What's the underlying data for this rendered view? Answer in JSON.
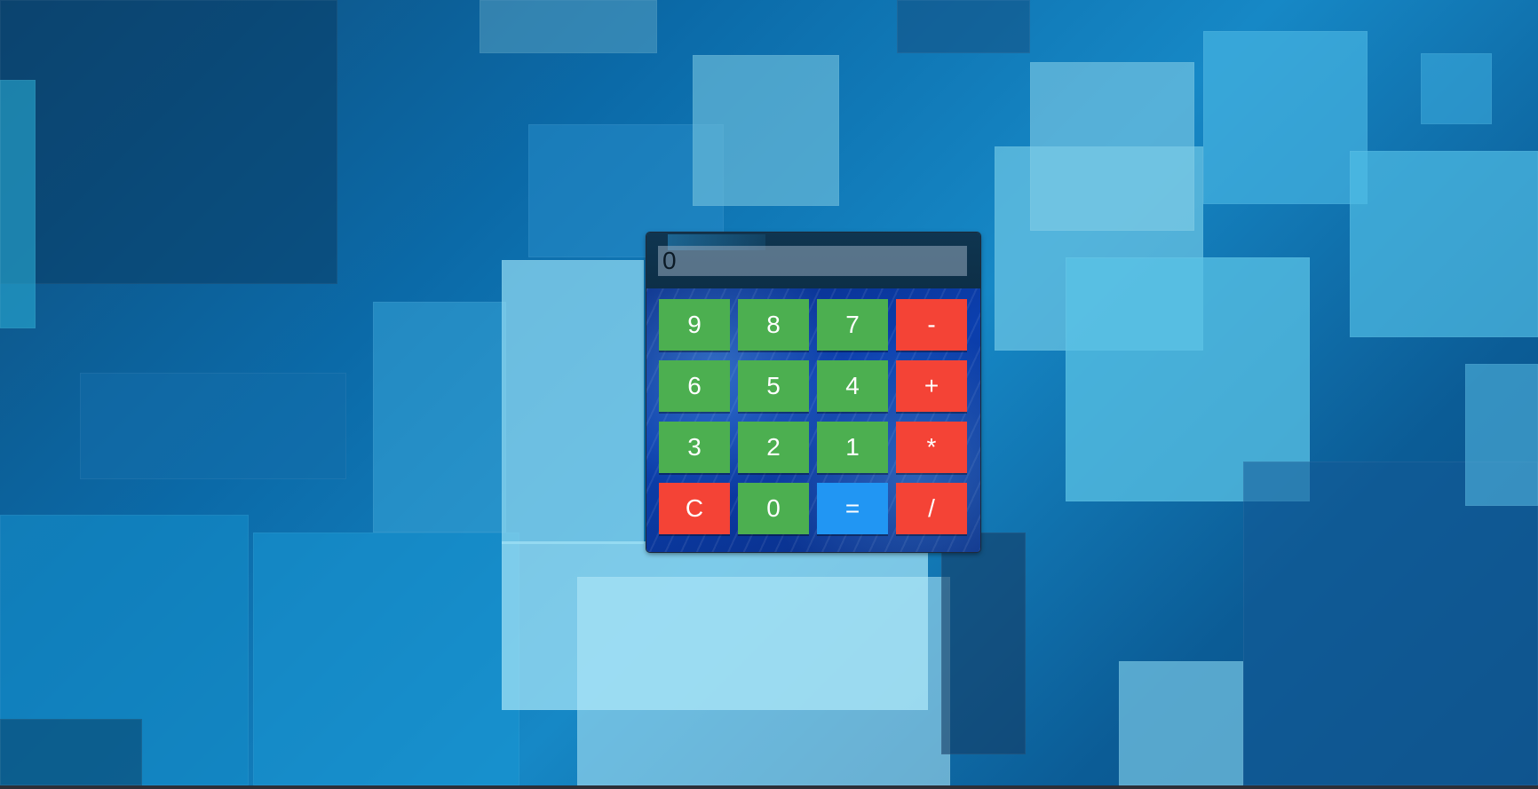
{
  "calculator": {
    "display_value": "0",
    "keys": {
      "k9": "9",
      "k8": "8",
      "k7": "7",
      "minus": "-",
      "k6": "6",
      "k5": "5",
      "k4": "4",
      "plus": "+",
      "k3": "3",
      "k2": "2",
      "k1": "1",
      "multiply": "*",
      "clear": "C",
      "k0": "0",
      "equals": "=",
      "divide": "/"
    }
  },
  "colors": {
    "number_key": "#4caf50",
    "operator_key": "#f44336",
    "equals_key": "#2196f3",
    "key_text": "#ffffff"
  }
}
